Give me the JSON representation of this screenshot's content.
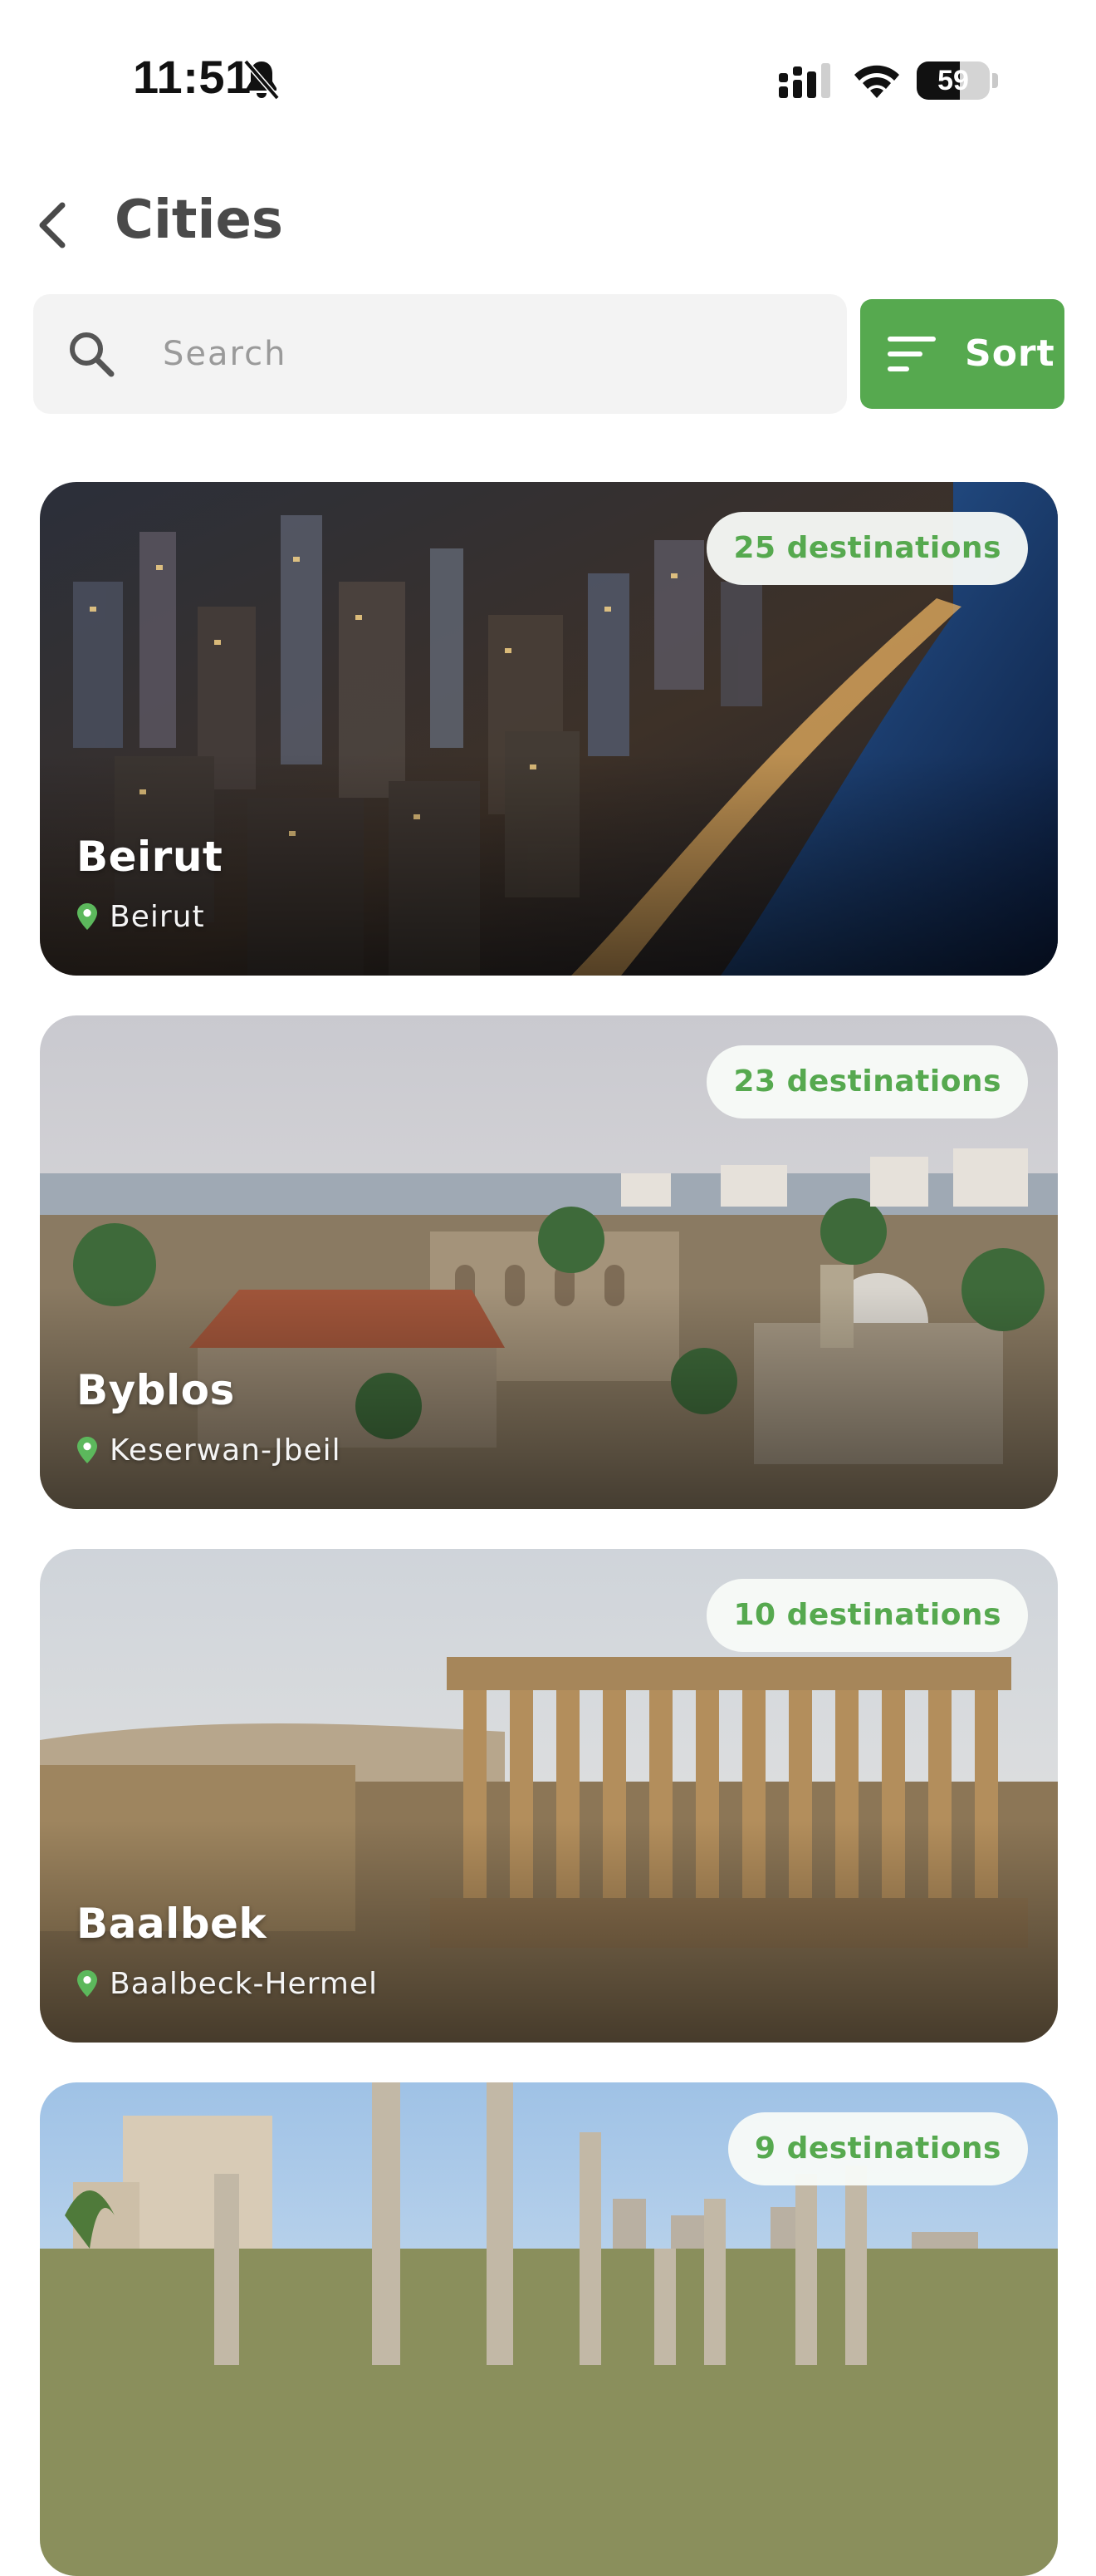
{
  "status_bar": {
    "time": "11:51",
    "battery_level": 59,
    "battery_text": "59",
    "icons": [
      "bell-slash-icon",
      "signal-icon",
      "wifi-icon",
      "battery-icon"
    ]
  },
  "header": {
    "back_icon": "chevron-left-icon",
    "title": "Cities"
  },
  "search": {
    "placeholder": "Search",
    "value": "",
    "icon": "search-icon"
  },
  "sort": {
    "label": "Sort",
    "icon": "sort-lines-icon"
  },
  "colors": {
    "accent": "#56a94f",
    "background": "#ffffff",
    "search_bg": "#f3f3f3",
    "title": "#4a4a4a"
  },
  "cities": [
    {
      "name": "Beirut",
      "region": "Beirut",
      "destinations": "25 destinations",
      "image": "city-skyline-night-photo"
    },
    {
      "name": "Byblos",
      "region": "Keserwan-Jbeil",
      "destinations": "23 destinations",
      "image": "old-town-coast-photo"
    },
    {
      "name": "Baalbek",
      "region": "Baalbeck-Hermel",
      "destinations": "10 destinations",
      "image": "roman-temple-ruins-photo"
    },
    {
      "name": "",
      "region": "",
      "destinations": "9 destinations",
      "image": "column-ruins-photo"
    }
  ]
}
